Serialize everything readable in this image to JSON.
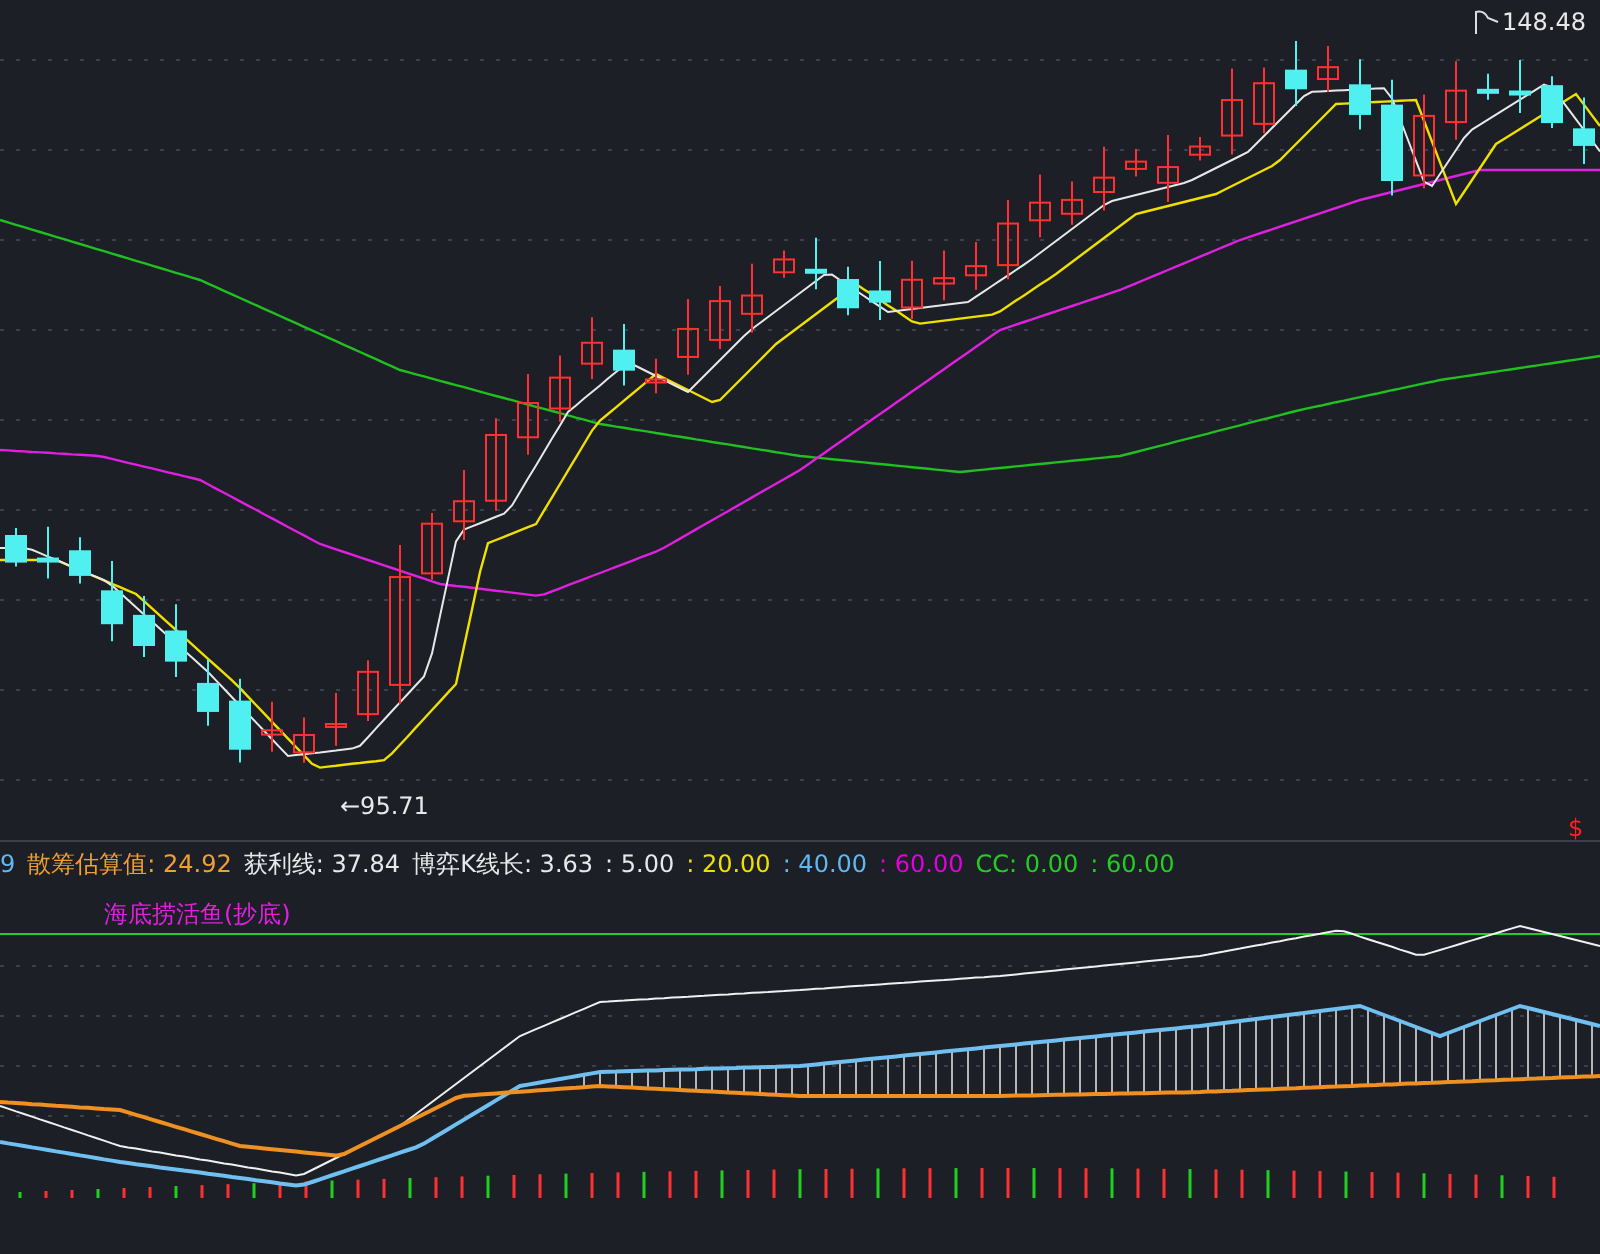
{
  "main_chart": {
    "high_label": "148.48",
    "low_label": "←95.71",
    "marker": "$"
  },
  "indicator_bar": {
    "segments": [
      {
        "text": "9",
        "color": "#5fb8f0"
      },
      {
        "text": "散筹估算值: 24.92",
        "color": "#f0a030"
      },
      {
        "text": "获利线: 37.84",
        "color": "#e8e8e8"
      },
      {
        "text": "博弈K线长: 3.63",
        "color": "#e8e8e8"
      },
      {
        "text": ": 5.00",
        "color": "#e8e8e8"
      },
      {
        "text": ": 20.00",
        "color": "#f0e000"
      },
      {
        "text": ": 40.00",
        "color": "#5fb8f0"
      },
      {
        "text": ": 60.00",
        "color": "#e000e0"
      },
      {
        "text": "CC: 0.00",
        "color": "#20d020"
      },
      {
        "text": ": 60.00",
        "color": "#20d020"
      }
    ]
  },
  "sub_chart": {
    "title": "海底捞活鱼(抄底)"
  }
}
